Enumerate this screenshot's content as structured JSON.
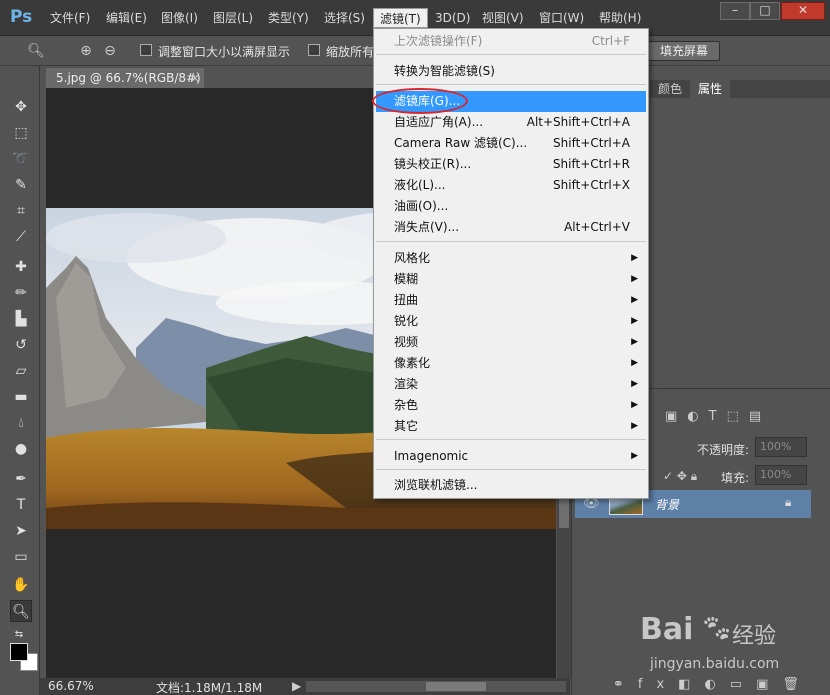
{
  "app": {
    "logo": "Ps"
  },
  "menubar": {
    "items": [
      "文件(F)",
      "编辑(E)",
      "图像(I)",
      "图层(L)",
      "类型(Y)",
      "选择(S)",
      "滤镜(T)",
      "3D(D)",
      "视图(V)",
      "窗口(W)",
      "帮助(H)"
    ],
    "active_item": "滤镜(T)",
    "window_controls": {
      "minimize": "–",
      "maximize": "□",
      "close": "✕"
    }
  },
  "options_bar": {
    "tool_icon": "zoom-icon",
    "resize_window_label": "调整窗口大小以满屏显示",
    "zoom_all_label": "缩放所有",
    "fill_screen_label": "填充屏幕"
  },
  "document": {
    "tab_title": "5.jpg @ 66.7%(RGB/8#)",
    "tab_close": "×",
    "zoom": "66.67%",
    "doc_size": "文档:1.18M/1.18M",
    "status_arrow": "▶"
  },
  "filter_menu": {
    "items": [
      {
        "label": "上次滤镜操作(F)",
        "shortcut": "Ctrl+F",
        "disabled": true
      },
      {
        "label": "转换为智能滤镜(S)",
        "shortcut": ""
      },
      {
        "label": "滤镜库(G)...",
        "shortcut": "",
        "highlight": true
      },
      {
        "label": "自适应广角(A)...",
        "shortcut": "Alt+Shift+Ctrl+A"
      },
      {
        "label": "Camera Raw 滤镜(C)...",
        "shortcut": "Shift+Ctrl+A"
      },
      {
        "label": "镜头校正(R)...",
        "shortcut": "Shift+Ctrl+R"
      },
      {
        "label": "液化(L)...",
        "shortcut": "Shift+Ctrl+X"
      },
      {
        "label": "油画(O)...",
        "shortcut": ""
      },
      {
        "label": "消失点(V)...",
        "shortcut": "Alt+Ctrl+V"
      },
      {
        "label": "风格化",
        "submenu": true
      },
      {
        "label": "模糊",
        "submenu": true
      },
      {
        "label": "扭曲",
        "submenu": true
      },
      {
        "label": "锐化",
        "submenu": true
      },
      {
        "label": "视频",
        "submenu": true
      },
      {
        "label": "像素化",
        "submenu": true
      },
      {
        "label": "渲染",
        "submenu": true
      },
      {
        "label": "杂色",
        "submenu": true
      },
      {
        "label": "其它",
        "submenu": true
      },
      {
        "label": "Imagenomic",
        "submenu": true
      },
      {
        "label": "浏览联机滤镜..."
      }
    ]
  },
  "panels": {
    "top_tabs": [
      "颜色",
      "属性"
    ],
    "active_top_tab": "属性",
    "layers": {
      "opacity_label": "不透明度:",
      "opacity_value": "100%",
      "fill_label": "填充:",
      "fill_value": "100%",
      "layer_name": "背景"
    }
  },
  "watermark": {
    "brand": "Bai",
    "brand_cn": "经验",
    "url": "jingyan.baidu.com"
  },
  "colors": {
    "highlight_blue": "#3399ff",
    "annotation_red": "#d9262c",
    "menu_bg": "#f0f0f0"
  }
}
